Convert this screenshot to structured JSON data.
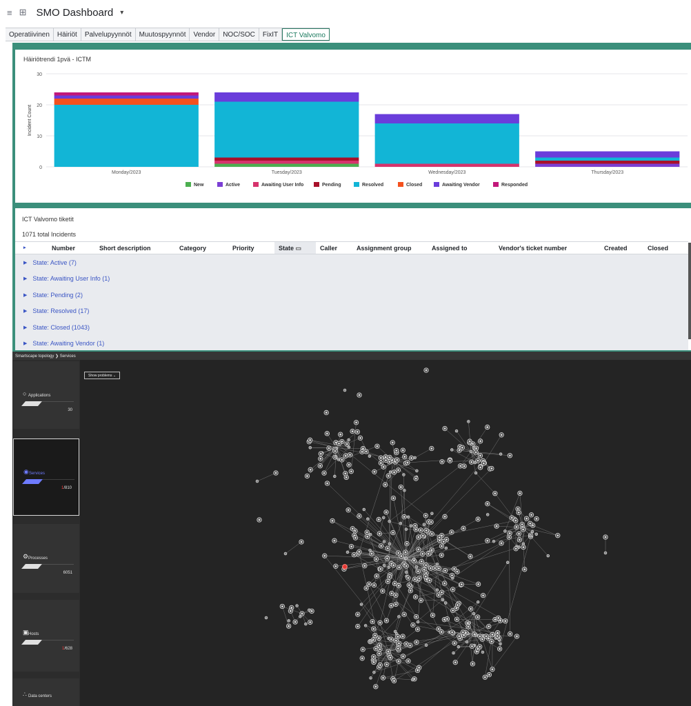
{
  "header": {
    "menu_icon": "hamburger-icon",
    "grid_icon": "dashboard-grid-icon",
    "title": "SMO Dashboard"
  },
  "tabs": [
    {
      "label": "Operatiivinen",
      "active": false
    },
    {
      "label": "Häiriöt",
      "active": false
    },
    {
      "label": "Palvelupyynnöt",
      "active": false
    },
    {
      "label": "Muutospyynnöt",
      "active": false
    },
    {
      "label": "Vendor",
      "active": false
    },
    {
      "label": "NOC/SOC",
      "active": false
    },
    {
      "label": "FixIT",
      "active": false
    },
    {
      "label": "ICT Valvomo",
      "active": true
    }
  ],
  "chart_card": {
    "title": "Häiriötrendi 1pvä - ICTM"
  },
  "chart_data": {
    "type": "bar",
    "stacked": true,
    "ylabel": "Incident Count",
    "ylim": [
      0,
      30
    ],
    "yticks": [
      0,
      10,
      20,
      30
    ],
    "grid": true,
    "legend_position": "bottom",
    "categories": [
      "Monday/2023",
      "Tuesday/2023",
      "Wednesday/2023",
      "Thursday/2023"
    ],
    "series": [
      {
        "name": "New",
        "color": "#4caf50",
        "values": [
          0,
          1,
          0,
          0
        ]
      },
      {
        "name": "Active",
        "color": "#7b3fd4",
        "values": [
          0,
          0,
          0,
          1
        ]
      },
      {
        "name": "Awaiting User Info",
        "color": "#d6336c",
        "values": [
          0,
          1,
          1,
          0
        ]
      },
      {
        "name": "Pending",
        "color": "#a8102a",
        "values": [
          0,
          1,
          0,
          1
        ]
      },
      {
        "name": "Resolved",
        "color": "#12b5d6",
        "values": [
          20,
          18,
          13,
          1
        ]
      },
      {
        "name": "Closed",
        "color": "#f4511e",
        "values": [
          2,
          0,
          0,
          0
        ]
      },
      {
        "name": "Awaiting Vendor",
        "color": "#6a3ddb",
        "values": [
          1,
          3,
          3,
          2
        ]
      },
      {
        "name": "Responded",
        "color": "#c2187a",
        "values": [
          1,
          0,
          0,
          0
        ]
      }
    ]
  },
  "table_card": {
    "title": "ICT Valvomo tiketit",
    "total": "1071 total Incidents",
    "columns": [
      "Number",
      "Short description",
      "Category",
      "Priority",
      "State",
      "Caller",
      "Assignment group",
      "Assigned to",
      "Vendor's ticket number",
      "Created",
      "Closed"
    ],
    "groups": [
      "State: Active (7)",
      "State: Awaiting User Info (1)",
      "State: Pending (2)",
      "State: Resolved (17)",
      "State: Closed (1043)",
      "State: Awaiting Vendor (1)"
    ]
  },
  "smartscape": {
    "breadcrumb_root": "Smartscape topology",
    "breadcrumb_current": "Services",
    "show_problems_label": "Show problems",
    "tiles": [
      {
        "label": "Applications",
        "count": "30",
        "problem": "",
        "selected": false,
        "icon": "application-icon"
      },
      {
        "label": "Services",
        "count": "/810",
        "problem": "1",
        "selected": true,
        "icon": "service-icon"
      },
      {
        "label": "Processes",
        "count": "6051",
        "problem": "",
        "selected": false,
        "icon": "process-icon"
      },
      {
        "label": "Hosts",
        "count": "/628",
        "problem": "1",
        "selected": false,
        "icon": "host-icon"
      },
      {
        "label": "Data centers",
        "count": "",
        "problem": "",
        "selected": false,
        "icon": "datacenter-icon"
      }
    ],
    "colors": {
      "problem_node": "#e53935",
      "node": "#d9d9d9",
      "edge": "#8a8a8a",
      "accent": "#6e7bff"
    }
  }
}
